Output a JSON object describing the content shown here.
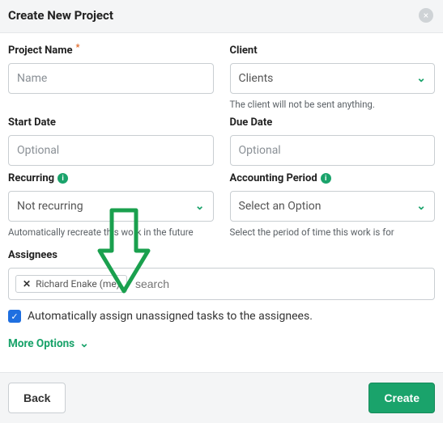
{
  "modal": {
    "title": "Create New Project",
    "close_label": "×"
  },
  "project_name": {
    "label": "Project Name",
    "placeholder": "Name"
  },
  "client": {
    "label": "Client",
    "selected": "Clients",
    "helper": "The client will not be sent anything."
  },
  "start_date": {
    "label": "Start Date",
    "placeholder": "Optional"
  },
  "due_date": {
    "label": "Due Date",
    "placeholder": "Optional"
  },
  "recurring": {
    "label": "Recurring",
    "selected": "Not recurring",
    "helper": "Automatically recreate this work in the future"
  },
  "accounting_period": {
    "label": "Accounting Period",
    "selected": "Select an Option",
    "helper": "Select the period of time this work is for"
  },
  "assignees": {
    "label": "Assignees",
    "chip_name": "Richard Enake (me)",
    "chip_remove": "✕",
    "search_placeholder": "search"
  },
  "auto_assign": {
    "label": "Automatically assign unassigned tasks to the assignees.",
    "checked": true,
    "checkmark": "✓"
  },
  "more_options": {
    "label": "More Options"
  },
  "footer": {
    "back": "Back",
    "create": "Create"
  },
  "info_glyph": "i"
}
